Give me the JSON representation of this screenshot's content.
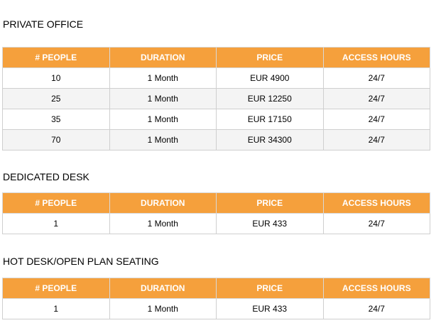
{
  "headers": [
    "# PEOPLE",
    "DURATION",
    "PRICE",
    "ACCESS HOURS"
  ],
  "sections": [
    {
      "title": "PRIVATE OFFICE",
      "rows": [
        [
          "10",
          "1 Month",
          "EUR 4900",
          "24/7"
        ],
        [
          "25",
          "1 Month",
          "EUR 12250",
          "24/7"
        ],
        [
          "35",
          "1 Month",
          "EUR 17150",
          "24/7"
        ],
        [
          "70",
          "1 Month",
          "EUR 34300",
          "24/7"
        ]
      ]
    },
    {
      "title": "DEDICATED DESK",
      "rows": [
        [
          "1",
          "1 Month",
          "EUR 433",
          "24/7"
        ]
      ]
    },
    {
      "title": "HOT DESK/OPEN PLAN SEATING",
      "rows": [
        [
          "1",
          "1 Month",
          "EUR 433",
          "24/7"
        ]
      ]
    }
  ],
  "colors": {
    "header_bg": "#f5a03c",
    "header_text": "#ffffff",
    "row_alt_bg": "#f4f4f4",
    "border": "#cfcfcf"
  }
}
